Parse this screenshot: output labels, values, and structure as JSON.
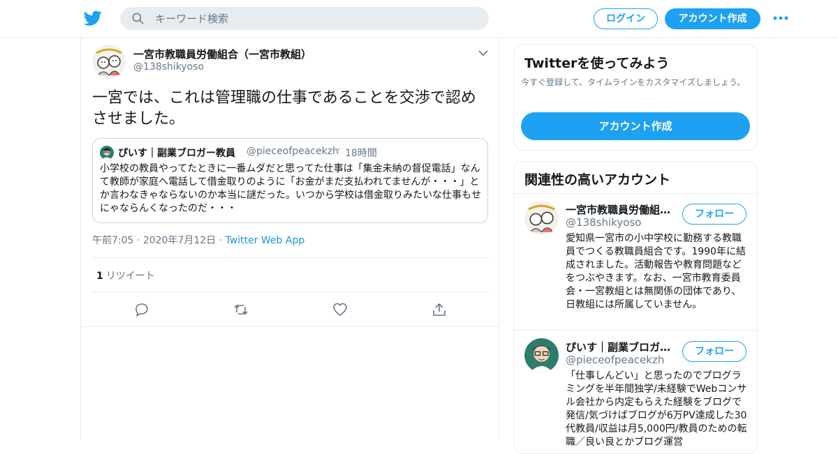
{
  "header": {
    "search_placeholder": "キーワード検索",
    "login_label": "ログイン",
    "signup_label": "アカウント作成"
  },
  "tweet": {
    "author_name": "一宮市教職員労働組合（一宮市教組）",
    "author_handle": "@138shikyoso",
    "text": "一宮では、これは管理職の仕事であることを交渉で認めさせました。",
    "quoted": {
      "author_name": "ぴいす｜副業ブロガー教員",
      "author_handle": "@pieceofpeacekzh",
      "dot": "·",
      "time": "18時間",
      "text": "小学校の教員やってたときに一番ムダだと思ってた仕事は「集金未納の督促電話」なんて教師が家庭へ電話して借金取りのように「お金がまだ支払われてませんが・・・」とか言わなきゃならないのか本当に謎だった。いつから学校は借金取りみたいな仕事もせにゃならんくなったのだ・・・"
    },
    "time": "午前7:05",
    "dot1": "·",
    "date": "2020年7月12日",
    "dot2": "·",
    "source": "Twitter Web App",
    "retweet_count": "1",
    "retweet_label": "リツイート"
  },
  "sidebar": {
    "try_title": "Twitterを使ってみよう",
    "try_sub": "今すぐ登録して、タイムラインをカスタマイズしましょう。",
    "try_button": "アカウント作成",
    "related_title": "関連性の高いアカウント",
    "accounts": [
      {
        "name": "一宮市教職員労働組合（一宮市教組）",
        "handle": "@138shikyoso",
        "follow": "フォロー",
        "bio": "愛知県一宮市の小中学校に勤務する教職員でつくる教職員組合です。1990年に結成されました。活動報告や教育問題などをつぶやきます。なお、一宮市教育委員会・一宮教組とは無関係の団体であり、日教組には所属していません。"
      },
      {
        "name": "ぴいす｜副業ブロガー教員",
        "handle": "@pieceofpeacekzh",
        "follow": "フォロー",
        "bio": "「仕事しんどい」と思ったのでプログラミングを半年間独学/未経験でWebコンサル会社から内定もらえた経験をブログで発信/気づけばブログが6万PV達成した30代教員/収益は月5,000円/教員のための転職／良い良とかブログ運営"
      }
    ]
  },
  "colors": {
    "accent": "#1da1f2",
    "border": "#e6ecf0",
    "muted": "#657786"
  }
}
